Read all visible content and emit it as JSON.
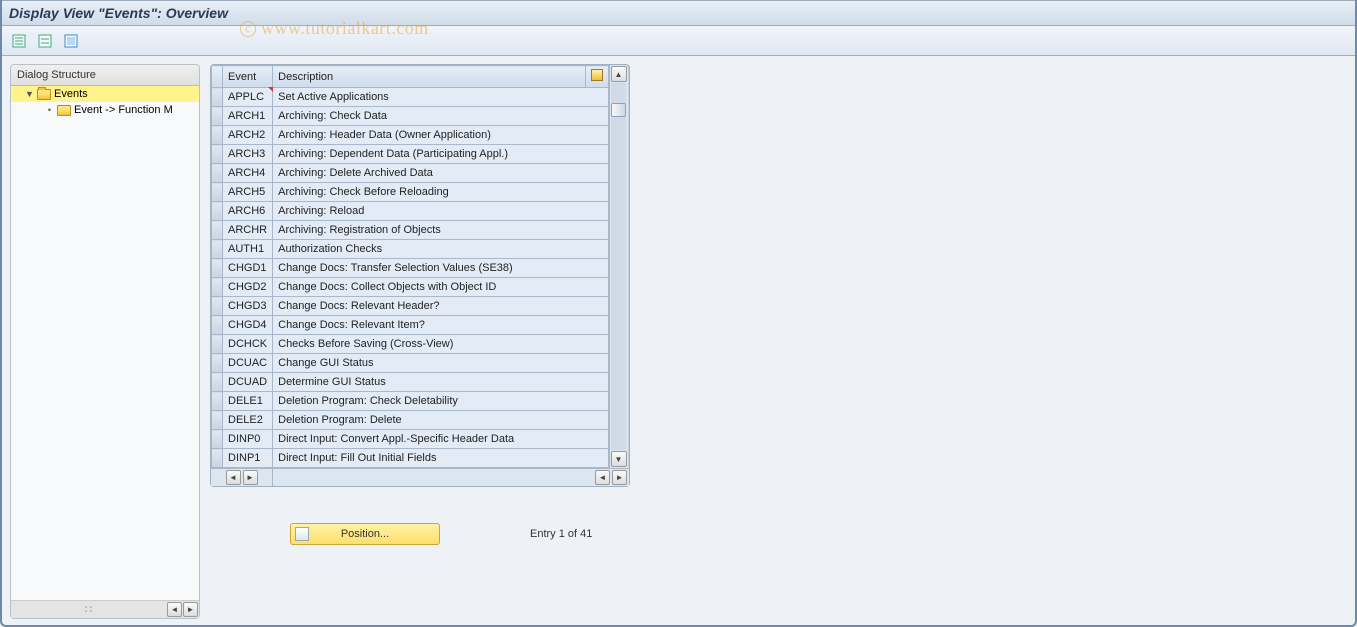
{
  "title": "Display View \"Events\": Overview",
  "watermark": "www.tutorialkart.com",
  "tree": {
    "header": "Dialog Structure",
    "root": {
      "label": "Events",
      "expanded": true
    },
    "child": {
      "label": "Event -> Function M"
    }
  },
  "table": {
    "columns": {
      "event": "Event",
      "description": "Description"
    },
    "rows": [
      {
        "event": "APPLC",
        "description": "Set Active Applications"
      },
      {
        "event": "ARCH1",
        "description": "Archiving: Check Data"
      },
      {
        "event": "ARCH2",
        "description": "Archiving: Header Data (Owner Application)"
      },
      {
        "event": "ARCH3",
        "description": "Archiving: Dependent Data (Participating Appl.)"
      },
      {
        "event": "ARCH4",
        "description": "Archiving: Delete Archived Data"
      },
      {
        "event": "ARCH5",
        "description": "Archiving: Check Before Reloading"
      },
      {
        "event": "ARCH6",
        "description": "Archiving: Reload"
      },
      {
        "event": "ARCHR",
        "description": "Archiving: Registration of Objects"
      },
      {
        "event": "AUTH1",
        "description": "Authorization Checks"
      },
      {
        "event": "CHGD1",
        "description": "Change Docs: Transfer Selection Values (SE38)"
      },
      {
        "event": "CHGD2",
        "description": "Change Docs: Collect Objects with Object ID"
      },
      {
        "event": "CHGD3",
        "description": "Change Docs: Relevant Header?"
      },
      {
        "event": "CHGD4",
        "description": "Change Docs: Relevant Item?"
      },
      {
        "event": "DCHCK",
        "description": "Checks Before Saving (Cross-View)"
      },
      {
        "event": "DCUAC",
        "description": "Change GUI Status"
      },
      {
        "event": "DCUAD",
        "description": "Determine GUI Status"
      },
      {
        "event": "DELE1",
        "description": "Deletion Program: Check Deletability"
      },
      {
        "event": "DELE2",
        "description": "Deletion Program: Delete"
      },
      {
        "event": "DINP0",
        "description": "Direct Input: Convert Appl.-Specific Header Data"
      },
      {
        "event": "DINP1",
        "description": "Direct Input: Fill Out Initial Fields"
      }
    ]
  },
  "footer": {
    "position_label": "Position...",
    "entry_text": "Entry 1 of 41"
  }
}
